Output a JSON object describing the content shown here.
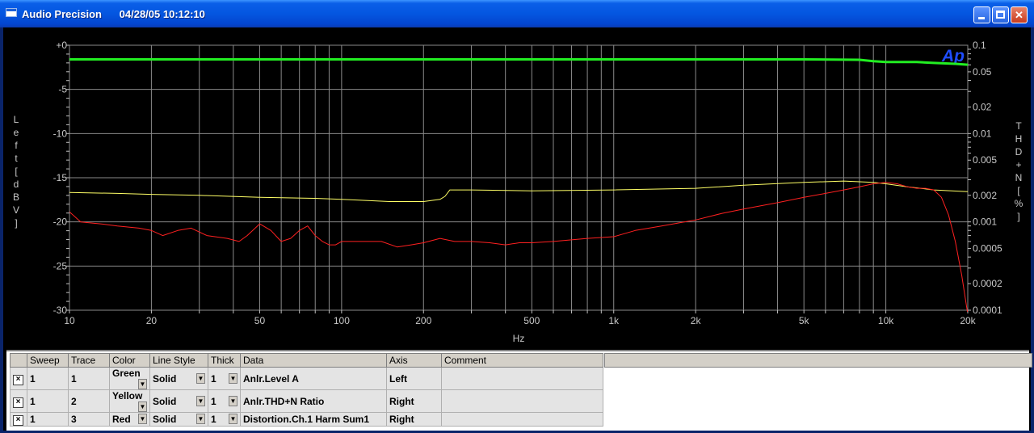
{
  "window": {
    "title": "Audio Precision",
    "timestamp": "04/28/05 10:12:10",
    "minimize": "",
    "maximize": "",
    "close": "✕"
  },
  "chart_data": {
    "type": "line",
    "xlabel": "Hz",
    "ylabel_left": "Left [dBV]",
    "ylabel_right": "THD+N [%]",
    "x_scale": "log",
    "xlim": [
      10,
      20000
    ],
    "ylim_left": [
      -30,
      0
    ],
    "ylim_right": [
      0.0001,
      0.1
    ],
    "y_right_scale": "log",
    "grid": true,
    "logo": "Ap",
    "x_ticks": [
      10,
      20,
      50,
      100,
      200,
      500,
      1000,
      2000,
      5000,
      10000,
      20000
    ],
    "x_tick_labels": [
      "10",
      "20",
      "50",
      "100",
      "200",
      "500",
      "1k",
      "2k",
      "5k",
      "10k",
      "20k"
    ],
    "y_left_ticks": [
      0,
      -5,
      -10,
      -15,
      -20,
      -25,
      -30
    ],
    "y_left_tick_labels": [
      "+0",
      "-5",
      "-10",
      "-15",
      "-20",
      "-25",
      "-30"
    ],
    "y_right_ticks": [
      0.1,
      0.05,
      0.02,
      0.01,
      0.005,
      0.002,
      0.001,
      0.0005,
      0.0002,
      0.0001
    ],
    "y_right_tick_labels": [
      "0.1",
      "0.05",
      "0.02",
      "0.01",
      "0.005",
      "0.002",
      "0.001",
      "0.0005",
      "0.0002",
      "0.0001"
    ],
    "series": [
      {
        "name": "Anlr.Level A",
        "color": "#22ee22",
        "axis": "left",
        "width": 3,
        "x": [
          10,
          50,
          100,
          500,
          1000,
          5000,
          8000,
          9000,
          10000,
          13000,
          15000,
          18000,
          20000
        ],
        "y": [
          -1.6,
          -1.6,
          -1.6,
          -1.6,
          -1.6,
          -1.6,
          -1.65,
          -1.8,
          -1.9,
          -1.9,
          -2.0,
          -2.1,
          -2.2
        ]
      },
      {
        "name": "Anlr.THD+N Ratio",
        "color": "#ffff66",
        "axis": "right",
        "width": 1,
        "x": [
          10,
          15,
          20,
          30,
          50,
          80,
          100,
          150,
          200,
          230,
          240,
          250,
          300,
          500,
          1000,
          2000,
          3000,
          5000,
          7000,
          9000,
          10000,
          12000,
          15000,
          20000
        ],
        "y": [
          0.00215,
          0.0021,
          0.00205,
          0.002,
          0.0019,
          0.00185,
          0.0018,
          0.0017,
          0.0017,
          0.0018,
          0.00195,
          0.0023,
          0.0023,
          0.00225,
          0.0023,
          0.0024,
          0.0026,
          0.0028,
          0.0029,
          0.0028,
          0.0027,
          0.0025,
          0.0023,
          0.0022
        ]
      },
      {
        "name": "Distortion.Ch.1 Harm Sum1",
        "color": "#ff2020",
        "axis": "right",
        "width": 1,
        "x": [
          10,
          11,
          13,
          15,
          18,
          20,
          22,
          25,
          28,
          32,
          38,
          42,
          45,
          50,
          55,
          60,
          65,
          70,
          75,
          80,
          85,
          90,
          95,
          100,
          120,
          140,
          160,
          180,
          200,
          230,
          260,
          300,
          350,
          400,
          450,
          500,
          600,
          800,
          1000,
          1200,
          1500,
          2000,
          2500,
          3000,
          4000,
          5000,
          6000,
          7000,
          8000,
          9000,
          10000,
          11000,
          12000,
          13000,
          14000,
          15000,
          16000,
          17000,
          18000,
          19000,
          20000
        ],
        "y": [
          0.0013,
          0.001,
          0.00095,
          0.0009,
          0.00085,
          0.0008,
          0.0007,
          0.0008,
          0.00085,
          0.0007,
          0.00065,
          0.0006,
          0.0007,
          0.00095,
          0.0008,
          0.0006,
          0.00065,
          0.0008,
          0.0009,
          0.0007,
          0.0006,
          0.00055,
          0.00055,
          0.0006,
          0.0006,
          0.0006,
          0.00052,
          0.00055,
          0.00058,
          0.00065,
          0.0006,
          0.0006,
          0.00058,
          0.00055,
          0.00058,
          0.00058,
          0.0006,
          0.00065,
          0.00068,
          0.0008,
          0.0009,
          0.00105,
          0.00125,
          0.0014,
          0.00165,
          0.0019,
          0.0021,
          0.0023,
          0.0025,
          0.0027,
          0.0028,
          0.0027,
          0.0025,
          0.0024,
          0.0024,
          0.0023,
          0.0019,
          0.0012,
          0.0006,
          0.00025,
          9e-05
        ]
      }
    ]
  },
  "grid": {
    "headers": [
      "Sweep",
      "Trace",
      "Color",
      "Line Style",
      "Thick",
      "Data",
      "Axis",
      "Comment"
    ],
    "rows": [
      {
        "sweep": "1",
        "trace": "1",
        "color": "Green",
        "style": "Solid",
        "thick": "1",
        "data": "Anlr.Level A",
        "axis": "Left",
        "comment": ""
      },
      {
        "sweep": "1",
        "trace": "2",
        "color": "Yellow",
        "style": "Solid",
        "thick": "1",
        "data": "Anlr.THD+N Ratio",
        "axis": "Right",
        "comment": ""
      },
      {
        "sweep": "1",
        "trace": "3",
        "color": "Red",
        "style": "Solid",
        "thick": "1",
        "data": "Distortion.Ch.1 Harm Sum1",
        "axis": "Right",
        "comment": ""
      }
    ],
    "checked_mark": "×",
    "dropdown_glyph": "▼"
  }
}
